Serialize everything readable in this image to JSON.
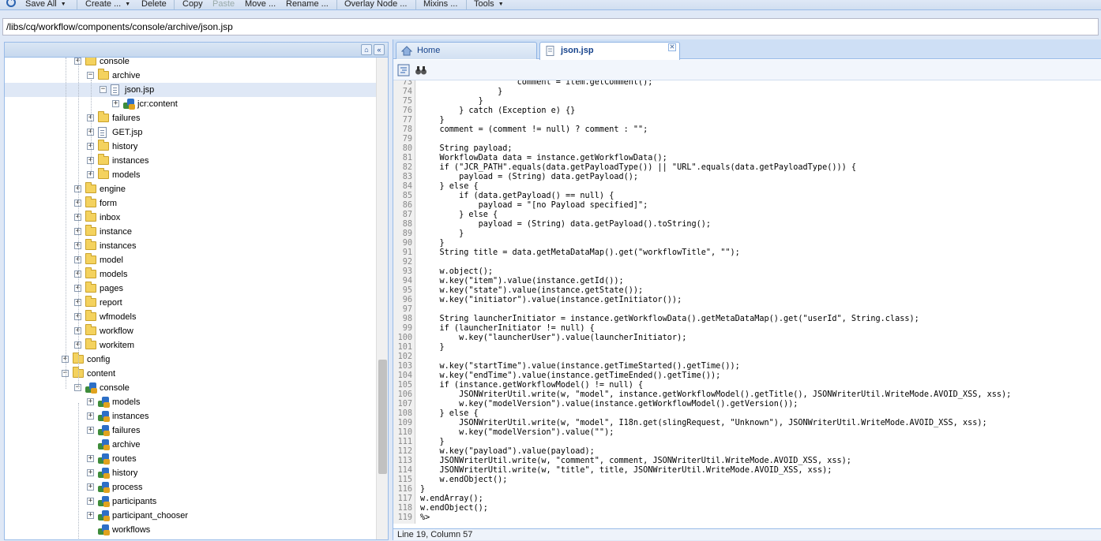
{
  "toolbar": {
    "save_all": "Save All",
    "create": "Create ...",
    "delete": "Delete",
    "copy": "Copy",
    "paste": "Paste",
    "move": "Move ...",
    "rename": "Rename ...",
    "overlay": "Overlay Node ...",
    "mixins": "Mixins ...",
    "tools": "Tools"
  },
  "path": "/libs/cq/workflow/components/console/archive/json.jsp",
  "tree": [
    {
      "label": "console",
      "type": "folder",
      "depth": 5
    },
    {
      "label": "archive",
      "type": "folder",
      "depth": 6,
      "expanded": true
    },
    {
      "label": "json.jsp",
      "type": "file",
      "depth": 7,
      "expanded": true,
      "selected": true
    },
    {
      "label": "jcr:content",
      "type": "node",
      "depth": 8
    },
    {
      "label": "failures",
      "type": "folder",
      "depth": 6
    },
    {
      "label": "GET.jsp",
      "type": "file",
      "depth": 6
    },
    {
      "label": "history",
      "type": "folder",
      "depth": 6
    },
    {
      "label": "instances",
      "type": "folder",
      "depth": 6
    },
    {
      "label": "models",
      "type": "folder",
      "depth": 6
    },
    {
      "label": "engine",
      "type": "folder",
      "depth": 5
    },
    {
      "label": "form",
      "type": "folder",
      "depth": 5
    },
    {
      "label": "inbox",
      "type": "folder",
      "depth": 5
    },
    {
      "label": "instance",
      "type": "folder",
      "depth": 5
    },
    {
      "label": "instances",
      "type": "folder",
      "depth": 5
    },
    {
      "label": "model",
      "type": "folder",
      "depth": 5
    },
    {
      "label": "models",
      "type": "folder",
      "depth": 5
    },
    {
      "label": "pages",
      "type": "folder",
      "depth": 5
    },
    {
      "label": "report",
      "type": "folder",
      "depth": 5
    },
    {
      "label": "wfmodels",
      "type": "folder",
      "depth": 5
    },
    {
      "label": "workflow",
      "type": "folder",
      "depth": 5
    },
    {
      "label": "workitem",
      "type": "folder",
      "depth": 5
    },
    {
      "label": "config",
      "type": "folder",
      "depth": 4
    },
    {
      "label": "content",
      "type": "folder",
      "depth": 4,
      "expanded": true
    },
    {
      "label": "console",
      "type": "node",
      "depth": 5,
      "expanded": true
    },
    {
      "label": "models",
      "type": "node",
      "depth": 6
    },
    {
      "label": "instances",
      "type": "node",
      "depth": 6
    },
    {
      "label": "failures",
      "type": "node",
      "depth": 6
    },
    {
      "label": "archive",
      "type": "node",
      "depth": 6,
      "leaf": true
    },
    {
      "label": "routes",
      "type": "node",
      "depth": 6
    },
    {
      "label": "history",
      "type": "node",
      "depth": 6
    },
    {
      "label": "process",
      "type": "node",
      "depth": 6
    },
    {
      "label": "participants",
      "type": "node",
      "depth": 6
    },
    {
      "label": "participant_chooser",
      "type": "node",
      "depth": 6
    },
    {
      "label": "workflows",
      "type": "node",
      "depth": 6,
      "leaf": true
    }
  ],
  "tabs": [
    {
      "label": "Home",
      "active": false
    },
    {
      "label": "json.jsp",
      "active": true
    }
  ],
  "code": [
    {
      "n": "73",
      "t": "                    comment = item.getComment();"
    },
    {
      "n": "74",
      "t": "                }"
    },
    {
      "n": "75",
      "t": "            }"
    },
    {
      "n": "76",
      "t": "        } catch (Exception e) {}"
    },
    {
      "n": "77",
      "t": "    }"
    },
    {
      "n": "78",
      "t": "    comment = (comment != null) ? comment : \"\";"
    },
    {
      "n": "79",
      "t": ""
    },
    {
      "n": "80",
      "t": "    String payload;"
    },
    {
      "n": "81",
      "t": "    WorkflowData data = instance.getWorkflowData();"
    },
    {
      "n": "82",
      "t": "    if (\"JCR_PATH\".equals(data.getPayloadType()) || \"URL\".equals(data.getPayloadType())) {"
    },
    {
      "n": "83",
      "t": "        payload = (String) data.getPayload();"
    },
    {
      "n": "84",
      "t": "    } else {"
    },
    {
      "n": "85",
      "t": "        if (data.getPayload() == null) {"
    },
    {
      "n": "86",
      "t": "            payload = \"[no Payload specified]\";"
    },
    {
      "n": "87",
      "t": "        } else {"
    },
    {
      "n": "88",
      "t": "            payload = (String) data.getPayload().toString();"
    },
    {
      "n": "89",
      "t": "        }"
    },
    {
      "n": "90",
      "t": "    }"
    },
    {
      "n": "91",
      "t": "    String title = data.getMetaDataMap().get(\"workflowTitle\", \"\");"
    },
    {
      "n": "92",
      "t": ""
    },
    {
      "n": "93",
      "t": "    w.object();"
    },
    {
      "n": "94",
      "t": "    w.key(\"item\").value(instance.getId());"
    },
    {
      "n": "95",
      "t": "    w.key(\"state\").value(instance.getState());"
    },
    {
      "n": "96",
      "t": "    w.key(\"initiator\").value(instance.getInitiator());"
    },
    {
      "n": "97",
      "t": ""
    },
    {
      "n": "98",
      "t": "    String launcherInitiator = instance.getWorkflowData().getMetaDataMap().get(\"userId\", String.class);"
    },
    {
      "n": "99",
      "t": "    if (launcherInitiator != null) {"
    },
    {
      "n": "100",
      "t": "        w.key(\"launcherUser\").value(launcherInitiator);"
    },
    {
      "n": "101",
      "t": "    }"
    },
    {
      "n": "102",
      "t": ""
    },
    {
      "n": "103",
      "t": "    w.key(\"startTime\").value(instance.getTimeStarted().getTime());"
    },
    {
      "n": "104",
      "t": "    w.key(\"endTime\").value(instance.getTimeEnded().getTime());"
    },
    {
      "n": "105",
      "t": "    if (instance.getWorkflowModel() != null) {"
    },
    {
      "n": "106",
      "t": "        JSONWriterUtil.write(w, \"model\", instance.getWorkflowModel().getTitle(), JSONWriterUtil.WriteMode.AVOID_XSS, xss);"
    },
    {
      "n": "107",
      "t": "        w.key(\"modelVersion\").value(instance.getWorkflowModel().getVersion());"
    },
    {
      "n": "108",
      "t": "    } else {"
    },
    {
      "n": "109",
      "t": "        JSONWriterUtil.write(w, \"model\", I18n.get(slingRequest, \"Unknown\"), JSONWriterUtil.WriteMode.AVOID_XSS, xss);"
    },
    {
      "n": "110",
      "t": "        w.key(\"modelVersion\").value(\"\");"
    },
    {
      "n": "111",
      "t": "    }"
    },
    {
      "n": "112",
      "t": "    w.key(\"payload\").value(payload);"
    },
    {
      "n": "113",
      "t": "    JSONWriterUtil.write(w, \"comment\", comment, JSONWriterUtil.WriteMode.AVOID_XSS, xss);"
    },
    {
      "n": "114",
      "t": "    JSONWriterUtil.write(w, \"title\", title, JSONWriterUtil.WriteMode.AVOID_XSS, xss);"
    },
    {
      "n": "115",
      "t": "    w.endObject();"
    },
    {
      "n": "116",
      "t": "}"
    },
    {
      "n": "117",
      "t": "w.endArray();"
    },
    {
      "n": "118",
      "t": "w.endObject();"
    },
    {
      "n": "119",
      "t": "%>"
    }
  ],
  "status": "Line 19, Column 57"
}
